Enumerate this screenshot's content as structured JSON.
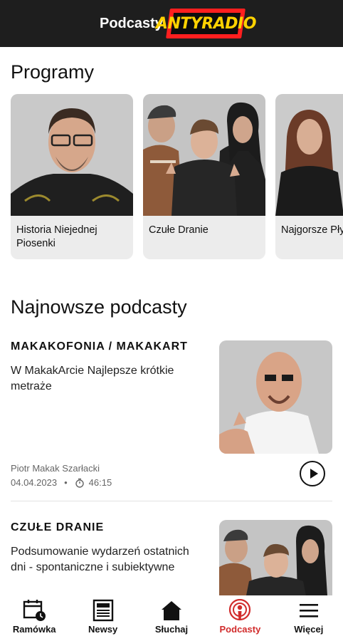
{
  "header": {
    "title": "Podcasty",
    "logo_text": "ANTYRADIO"
  },
  "programs": {
    "heading": "Programy",
    "items": [
      {
        "label": "Historia Niejednej Piosenki"
      },
      {
        "label": "Czułe Dranie"
      },
      {
        "label": "Najgorsze Płyty Świata"
      }
    ]
  },
  "latest": {
    "heading": "Najnowsze podcasty",
    "items": [
      {
        "show": "MAKAKOFONIA / MAKAKART",
        "title": "W MakakArcie Najlepsze krótkie metraże",
        "author": "Piotr Makak Szarłacki",
        "date": "04.04.2023",
        "separator": "•",
        "duration": "46:15"
      },
      {
        "show": "CZUŁE DRANIE",
        "title": "Podsumowanie wydarzeń ostatnich dni - spontaniczne i subiektywne"
      }
    ]
  },
  "nav": {
    "items": [
      {
        "label": "Ramówka",
        "icon": "schedule-icon"
      },
      {
        "label": "Newsy",
        "icon": "news-icon"
      },
      {
        "label": "Słuchaj",
        "icon": "home-icon"
      },
      {
        "label": "Podcasty",
        "icon": "podcast-icon",
        "active": true
      },
      {
        "label": "Więcej",
        "icon": "menu-icon"
      }
    ]
  },
  "colors": {
    "header_bg": "#1e1e1e",
    "accent": "#d12b2b",
    "logo_yellow": "#ffd200",
    "logo_red": "#ff1f1f"
  }
}
